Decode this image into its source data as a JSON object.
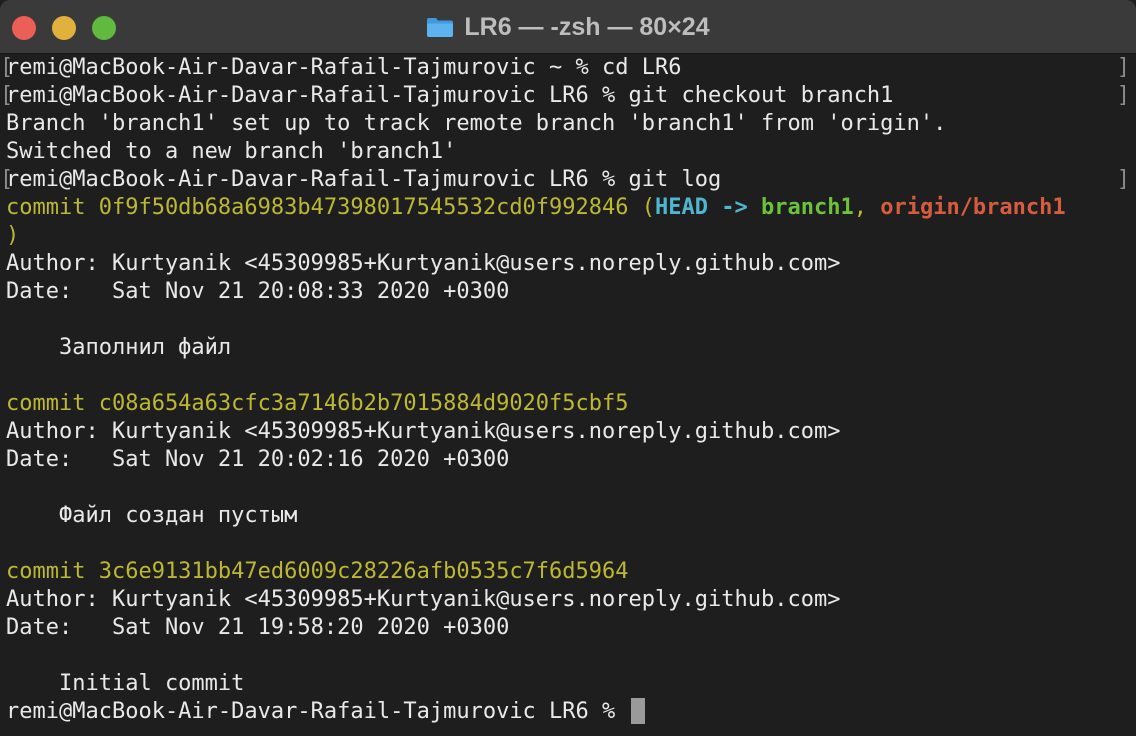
{
  "window": {
    "title": "LR6 — -zsh — 80×24",
    "title_icon": "folder-icon",
    "colors": {
      "close": "#ec5f57",
      "minimize": "#e2b03d",
      "maximize": "#5fba3f"
    }
  },
  "terminal": {
    "prompt_cmd1": "remi@MacBook-Air-Davar-Rafail-Tajmurovic ~ % cd LR6",
    "prompt_cmd2": "remi@MacBook-Air-Davar-Rafail-Tajmurovic LR6 % git checkout branch1",
    "output_branch_setup": "Branch 'branch1' set up to track remote branch 'branch1' from 'origin'.",
    "output_switched": "Switched to a new branch 'branch1'",
    "prompt_cmd3": "remi@MacBook-Air-Davar-Rafail-Tajmurovic LR6 % git log",
    "commits": [
      {
        "commit_line": "commit 0f9f50db68a6983b47398017545532cd0f992846",
        "refs_open": " (",
        "head": "HEAD -> ",
        "branch": "branch1",
        "comma": ", ",
        "origin_branch": "origin/branch1",
        "refs_close": ")",
        "author": "Author: Kurtyanik <45309985+Kurtyanik@users.noreply.github.com>",
        "date": "Date:   Sat Nov 21 20:08:33 2020 +0300",
        "message": "    Заполнил файл"
      },
      {
        "commit_line": "commit c08a654a63cfc3a7146b2b7015884d9020f5cbf5",
        "author": "Author: Kurtyanik <45309985+Kurtyanik@users.noreply.github.com>",
        "date": "Date:   Sat Nov 21 20:02:16 2020 +0300",
        "message": "    Файл создан пустым"
      },
      {
        "commit_line": "commit 3c6e9131bb47ed6009c28226afb0535c7f6d5964",
        "author": "Author: Kurtyanik <45309985+Kurtyanik@users.noreply.github.com>",
        "date": "Date:   Sat Nov 21 19:58:20 2020 +0300",
        "message": "    Initial commit"
      }
    ],
    "final_prompt": "remi@MacBook-Air-Davar-Rafail-Tajmurovic LR6 % ",
    "bracket_open": "[",
    "bracket_close": "]",
    "colors": {
      "commit": "#bdb733",
      "head": "#4fb6cf",
      "branch": "#6cc23c",
      "origin": "#d65c3f",
      "text": "#e9e9e9"
    }
  }
}
